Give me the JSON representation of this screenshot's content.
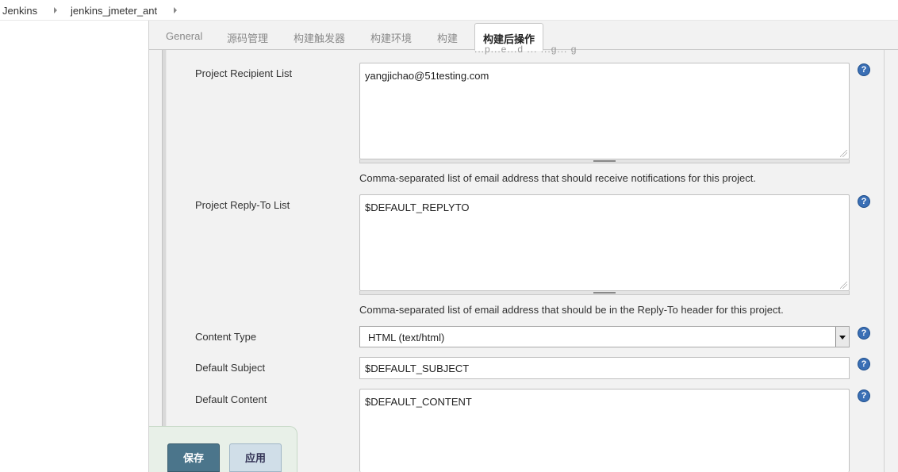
{
  "breadcrumb": {
    "items": [
      "Jenkins",
      "jenkins_jmeter_ant"
    ]
  },
  "tabs": [
    "General",
    "源码管理",
    "构建触发器",
    "构建环境",
    "构建",
    "构建后操作"
  ],
  "active_tab": "构建后操作",
  "clipped_text": "...p...e...d ... ...g... g",
  "fields": {
    "recipient": {
      "label": "Project Recipient List",
      "value": "yangjichao@51testing.com",
      "description": "Comma-separated list of email address that should receive notifications for this project."
    },
    "reply_to": {
      "label": "Project Reply-To List",
      "value": "$DEFAULT_REPLYTO",
      "description": "Comma-separated list of email address that should be in the Reply-To header for this project."
    },
    "content_type": {
      "label": "Content Type",
      "value": "HTML (text/html)"
    },
    "subject": {
      "label": "Default Subject",
      "value": "$DEFAULT_SUBJECT"
    },
    "content": {
      "label": "Default Content",
      "value": "$DEFAULT_CONTENT"
    }
  },
  "help_glyph": "?",
  "buttons": {
    "save": "保存",
    "apply": "应用"
  },
  "colors": {
    "save_bg": "#4b758b",
    "help_bg": "#3a6fb5",
    "panel_bg": "#f2f2f2"
  }
}
